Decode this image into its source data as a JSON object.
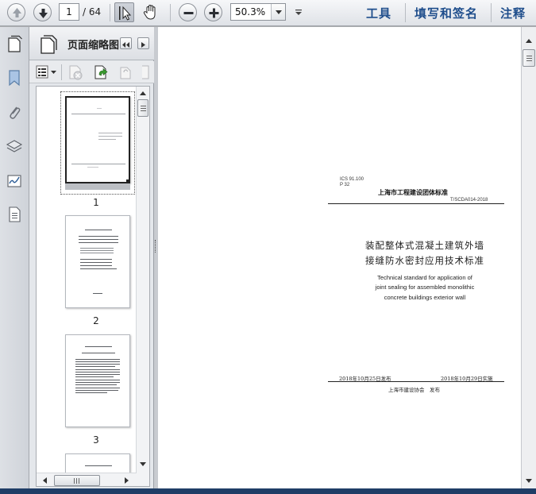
{
  "toolbar": {
    "current_page": "1",
    "total_pages": "/ 64",
    "zoom": "50.3%",
    "menus": [
      "工具",
      "填写和签名",
      "注释"
    ]
  },
  "panel": {
    "title": "页面缩略图",
    "thumbnails": [
      {
        "label": "1"
      },
      {
        "label": "2"
      },
      {
        "label": "3"
      }
    ]
  },
  "document": {
    "ics": "ICS 91.100",
    "p_code": "P 32",
    "organization": "上海市工程建设团体标准",
    "standard_no": "T/SCDA014-2018",
    "title_cn_line1": "装配整体式混凝土建筑外墙",
    "title_cn_line2": "接缝防水密封应用技术标准",
    "title_en_line1": "Technical standard for application of",
    "title_en_line2": "joint sealing for assembled monolithic",
    "title_en_line3": "concrete buildings exterior wall",
    "issue_date": "2018年10月25日发布",
    "effective_date": "2018年10月29日实施",
    "publisher": "上海市建设协会　发布"
  },
  "colors": {
    "accent": "#1f4e8c",
    "toolbar_bg": "#dfe2e7",
    "workspace_bg": "#a9abae"
  }
}
